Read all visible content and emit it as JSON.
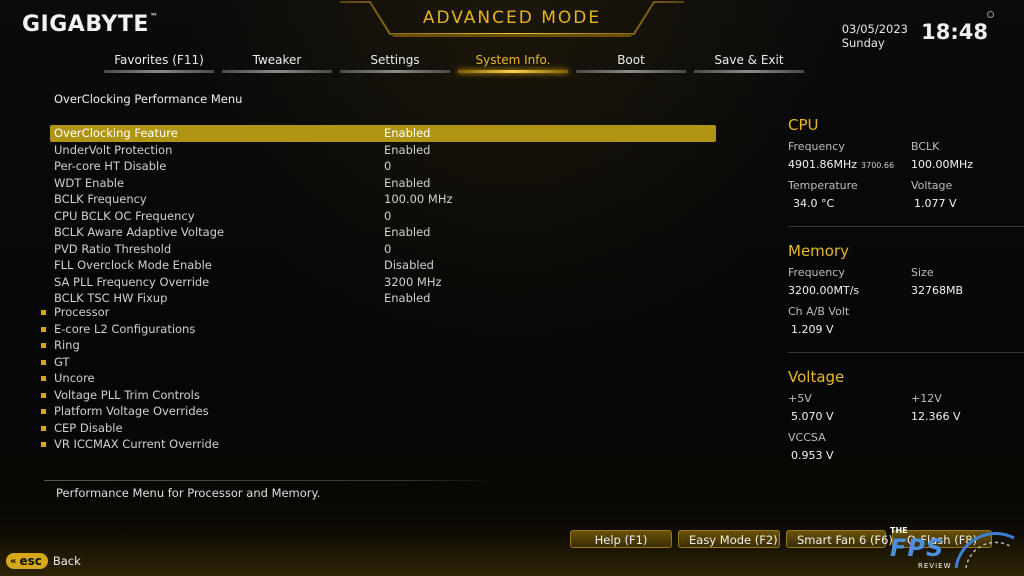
{
  "header": {
    "brand": "GIGABYTE",
    "brand_mark": "™",
    "mode_title": "ADVANCED MODE",
    "date": "03/05/2023",
    "day": "Sunday",
    "time": "18:48"
  },
  "tabs": [
    {
      "label": "Favorites (F11)",
      "active": false
    },
    {
      "label": "Tweaker",
      "active": false
    },
    {
      "label": "Settings",
      "active": false
    },
    {
      "label": "System Info.",
      "active": true
    },
    {
      "label": "Boot",
      "active": false
    },
    {
      "label": "Save & Exit",
      "active": false
    }
  ],
  "main": {
    "menu_title": "OverClocking Performance Menu",
    "settings": [
      {
        "label": "OverClocking Feature",
        "value": "Enabled",
        "selected": true
      },
      {
        "label": "UnderVolt Protection",
        "value": "Enabled"
      },
      {
        "label": "Per-core HT Disable",
        "value": "0"
      },
      {
        "label": "WDT Enable",
        "value": "Enabled"
      },
      {
        "label": "BCLK Frequency",
        "value": "100.00 MHz"
      },
      {
        "label": "CPU BCLK OC Frequency",
        "value": "0"
      },
      {
        "label": "BCLK Aware Adaptive Voltage",
        "value": "Enabled"
      },
      {
        "label": "PVD Ratio Threshold",
        "value": "0"
      },
      {
        "label": "FLL Overclock Mode Enable",
        "value": "Disabled"
      },
      {
        "label": "SA PLL Frequency Override",
        "value": "3200 MHz"
      },
      {
        "label": "BCLK TSC HW Fixup",
        "value": "Enabled"
      }
    ],
    "submenus": [
      "Processor",
      "E-core L2 Configurations",
      "Ring",
      "GT",
      "Uncore",
      "Voltage PLL Trim Controls",
      "Platform Voltage Overrides",
      "CEP Disable",
      "VR ICCMAX Current Override"
    ],
    "help_text": "Performance Menu for Processor and Memory."
  },
  "info": {
    "cpu": {
      "title": "CPU",
      "frequency_label": "Frequency",
      "frequency_value": "4901.86MHz",
      "frequency_sub": "3700.66",
      "bclk_label": "BCLK",
      "bclk_value": "100.00MHz",
      "temperature_label": "Temperature",
      "temperature_value": "34.0 °C",
      "voltage_label": "Voltage",
      "voltage_value": "1.077 V"
    },
    "memory": {
      "title": "Memory",
      "frequency_label": "Frequency",
      "frequency_value": "3200.00MT/s",
      "size_label": "Size",
      "size_value": "32768MB",
      "volt_label": "Ch A/B Volt",
      "volt_value": "1.209 V"
    },
    "voltage": {
      "title": "Voltage",
      "v5_label": "+5V",
      "v5_value": "5.070 V",
      "v12_label": "+12V",
      "v12_value": "12.366 V",
      "vccsa_label": "VCCSA",
      "vccsa_value": "0.953 V"
    }
  },
  "footer": {
    "esc_label": "esc",
    "back_label": "Back",
    "fkeys": [
      "Help (F1)",
      "Easy Mode (F2)",
      "Smart Fan 6 (F6)",
      "Q-Flash (F8)"
    ]
  },
  "watermark": {
    "line1": "THE",
    "line2": "FPS",
    "line3": "REVIEW"
  },
  "colors": {
    "accent": "#e8b828",
    "selected_row": "#b09414",
    "background": "#050505"
  }
}
